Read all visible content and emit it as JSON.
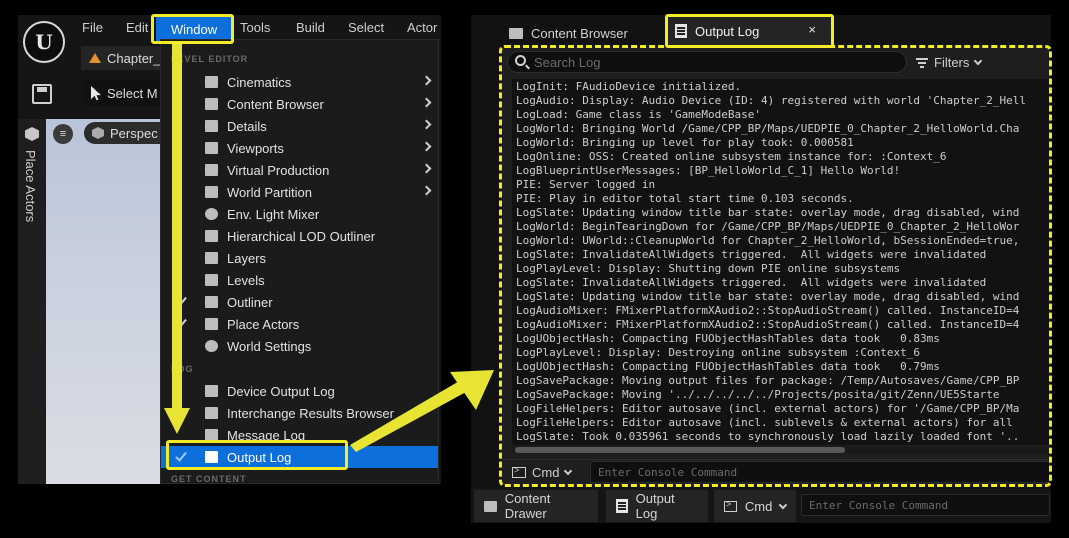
{
  "menubar": {
    "items": [
      "File",
      "Edit",
      "Window",
      "Tools",
      "Build",
      "Select",
      "Actor"
    ],
    "active": "Window"
  },
  "level_tab": {
    "label": "Chapter_"
  },
  "toolbar": {
    "select_mode": "Select M"
  },
  "viewport": {
    "perspective_label": "Perspec"
  },
  "side_panel": {
    "place_actors_label": "Place Actors"
  },
  "window_menu": {
    "sections": {
      "level_editor": "LEVEL EDITOR",
      "log": "LOG",
      "get_content": "GET CONTENT"
    },
    "level_items": [
      {
        "label": "Cinematics",
        "icon": "cinematics-icon",
        "submenu": true,
        "checked": false
      },
      {
        "label": "Content Browser",
        "icon": "content-browser-icon",
        "submenu": true,
        "checked": false
      },
      {
        "label": "Details",
        "icon": "details-icon",
        "submenu": true,
        "checked": false
      },
      {
        "label": "Viewports",
        "icon": "viewports-icon",
        "submenu": true,
        "checked": false
      },
      {
        "label": "Virtual Production",
        "icon": "virtual-production-icon",
        "submenu": true,
        "checked": false
      },
      {
        "label": "World Partition",
        "icon": "world-partition-icon",
        "submenu": true,
        "checked": false
      },
      {
        "label": "Env. Light Mixer",
        "icon": "light-mixer-icon",
        "submenu": false,
        "checked": false
      },
      {
        "label": "Hierarchical LOD Outliner",
        "icon": "hlod-icon",
        "submenu": false,
        "checked": false
      },
      {
        "label": "Layers",
        "icon": "layers-icon",
        "submenu": false,
        "checked": false
      },
      {
        "label": "Levels",
        "icon": "levels-icon",
        "submenu": false,
        "checked": false
      },
      {
        "label": "Outliner",
        "icon": "outliner-icon",
        "submenu": false,
        "checked": true
      },
      {
        "label": "Place Actors",
        "icon": "place-actors-icon",
        "submenu": false,
        "checked": true
      },
      {
        "label": "World Settings",
        "icon": "world-settings-icon",
        "submenu": false,
        "checked": false
      }
    ],
    "log_items": [
      {
        "label": "Device Output Log",
        "icon": "device-output-log-icon",
        "checked": false
      },
      {
        "label": "Interchange Results Browser",
        "icon": "interchange-icon",
        "checked": false
      },
      {
        "label": "Message Log",
        "icon": "message-log-icon",
        "checked": false
      },
      {
        "label": "Output Log",
        "icon": "output-log-icon",
        "checked": true,
        "active": true
      }
    ]
  },
  "output_panel": {
    "tabs": [
      {
        "label": "Content Browser",
        "icon": "folder-icon"
      },
      {
        "label": "Output Log",
        "icon": "output-log-icon",
        "active": true,
        "close": "×"
      }
    ],
    "search_placeholder": "Search Log",
    "filters_label": "Filters",
    "log_lines": [
      "LogInit: FAudioDevice initialized.",
      "LogAudio: Display: Audio Device (ID: 4) registered with world 'Chapter_2_Hell",
      "LogLoad: Game class is 'GameModeBase'",
      "LogWorld: Bringing World /Game/CPP_BP/Maps/UEDPIE_0_Chapter_2_HelloWorld.Cha",
      "LogWorld: Bringing up level for play took: 0.000581",
      "LogOnline: OSS: Created online subsystem instance for: :Context_6",
      "LogBlueprintUserMessages: [BP_HelloWorld_C_1] Hello World!",
      "PIE: Server logged in",
      "PIE: Play in editor total start time 0.103 seconds.",
      "LogSlate: Updating window title bar state: overlay mode, drag disabled, wind",
      "LogWorld: BeginTearingDown for /Game/CPP_BP/Maps/UEDPIE_0_Chapter_2_HelloWor",
      "LogWorld: UWorld::CleanupWorld for Chapter_2_HelloWorld, bSessionEnded=true,",
      "LogSlate: InvalidateAllWidgets triggered.  All widgets were invalidated",
      "LogPlayLevel: Display: Shutting down PIE online subsystems",
      "LogSlate: InvalidateAllWidgets triggered.  All widgets were invalidated",
      "LogSlate: Updating window title bar state: overlay mode, drag disabled, wind",
      "LogAudioMixer: FMixerPlatformXAudio2::StopAudioStream() called. InstanceID=4",
      "LogAudioMixer: FMixerPlatformXAudio2::StopAudioStream() called. InstanceID=4",
      "LogUObjectHash: Compacting FUObjectHashTables data took   0.83ms",
      "LogPlayLevel: Display: Destroying online subsystem :Context_6",
      "LogUObjectHash: Compacting FUObjectHashTables data took   0.79ms",
      "LogSavePackage: Moving output files for package: /Temp/Autosaves/Game/CPP_BP",
      "LogSavePackage: Moving '../../../../../Projects/posita/git/Zenn/UE5Starte",
      "LogFileHelpers: Editor autosave (incl. external actors) for '/Game/CPP_BP/Ma",
      "LogFileHelpers: Editor autosave (incl. sublevels & external actors) for all",
      "LogSlate: Took 0.035961 seconds to synchronously load lazily loaded font '.."
    ],
    "cmd_label": "Cmd",
    "console_placeholder": "Enter Console Command"
  },
  "bottom_bar": {
    "content_drawer": "Content Drawer",
    "output_log": "Output Log",
    "cmd_label": "Cmd",
    "console_placeholder": "Enter Console Command"
  },
  "colors": {
    "accent": "#0d6fdc",
    "highlight": "#f2ec27",
    "panel_bg": "#1e1e1e",
    "log_bg": "#121212"
  }
}
